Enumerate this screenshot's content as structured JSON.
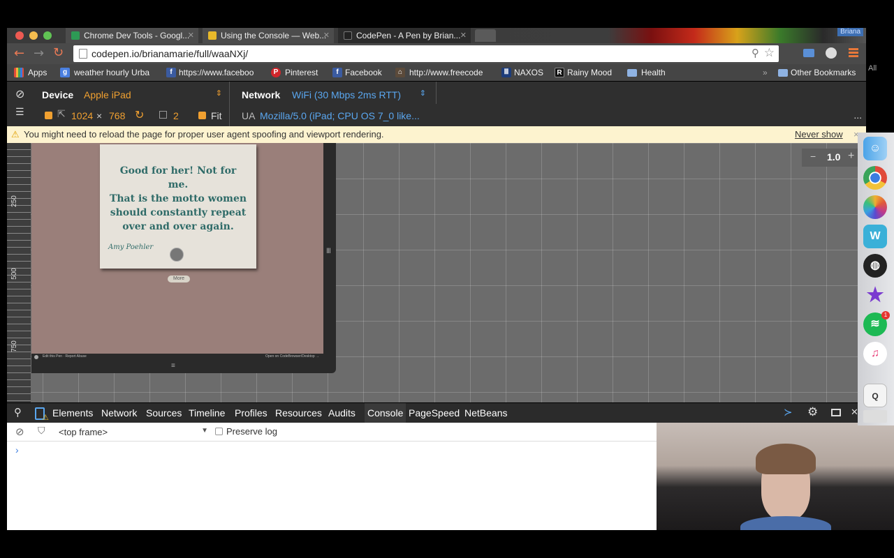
{
  "browser": {
    "tabs": [
      {
        "title": "Chrome Dev Tools - Googl..."
      },
      {
        "title": "Using the Console — Web..."
      },
      {
        "title": "CodePen - A Pen by Brian..."
      }
    ],
    "profile_name": "Briana",
    "url": "codepen.io/brianamarie/full/waaNXj/",
    "bookmarks": [
      {
        "label": "Apps",
        "icon": "apps-grid-icon"
      },
      {
        "label": "weather hourly Urba",
        "icon": "google-icon"
      },
      {
        "label": "https://www.faceboo",
        "icon": "facebook-icon"
      },
      {
        "label": "Pinterest",
        "icon": "pinterest-icon"
      },
      {
        "label": "Facebook",
        "icon": "facebook-icon"
      },
      {
        "label": "http://www.freecode",
        "icon": "freecodecamp-icon"
      },
      {
        "label": "NAXOS",
        "icon": "naxos-icon"
      },
      {
        "label": "Rainy Mood",
        "icon": "rainy-mood-icon"
      },
      {
        "label": "Health",
        "icon": "folder-icon"
      }
    ],
    "overflow_bookmarks": "»",
    "other_bookmarks": "Other Bookmarks",
    "side_label": "All"
  },
  "emulation": {
    "device_label": "Device",
    "device_value": "Apple iPad",
    "network_label": "Network",
    "network_value": "WiFi (30 Mbps 2ms RTT)",
    "width": "1024",
    "times": "×",
    "height": "768",
    "scale": "2",
    "fit_label": "Fit",
    "ua_label": "UA",
    "ua_value": "Mozilla/5.0 (iPad; CPU OS 7_0 like...",
    "more": "..."
  },
  "warning": {
    "text": "You might need to reload the page for proper user agent spoofing and viewport rendering.",
    "dismiss": "Never show",
    "close": "×"
  },
  "viewport": {
    "ruler_labels": [
      "250",
      "500",
      "750"
    ],
    "zoom_minus": "−",
    "zoom_value": "1.0",
    "zoom_plus": "+"
  },
  "page": {
    "quote_lines": [
      "Good for her! Not for me.",
      "That is the motto women",
      "should constantly repeat",
      "over and over again."
    ],
    "author": "Amy Poehler",
    "more_button": "More",
    "footer_left": "Edit this Pen · Report Abuse",
    "footer_right": "Open on CodeBrowser/Desktop →"
  },
  "devtools": {
    "tabs": [
      "Elements",
      "Network",
      "Sources",
      "Timeline",
      "Profiles",
      "Resources",
      "Audits",
      "Console",
      "PageSpeed",
      "NetBeans"
    ],
    "active_tab": "Console",
    "frame_selector": "<top frame>",
    "preserve_log": "Preserve log",
    "prompt": "›"
  },
  "dock": {
    "badge": "1"
  },
  "colors": {
    "accent_orange": "#f0a030",
    "accent_blue": "#5aa7f0",
    "quote_teal": "#2f6b68"
  }
}
